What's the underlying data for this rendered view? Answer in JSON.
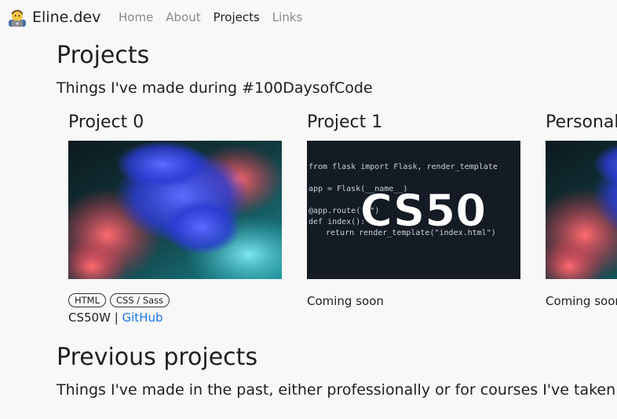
{
  "brand": {
    "name": "Eline.dev",
    "icon": "technologist-emoji-icon"
  },
  "nav": {
    "items": [
      {
        "label": "Home",
        "active": false
      },
      {
        "label": "About",
        "active": false
      },
      {
        "label": "Projects",
        "active": true
      },
      {
        "label": "Links",
        "active": false
      }
    ]
  },
  "projects": {
    "heading": "Projects",
    "intro": "Things I've made during #100DaysofCode",
    "cards": [
      {
        "title": "Project 0",
        "tags": [
          "HTML",
          "CSS / Sass"
        ],
        "credit_prefix": "CS50W",
        "credit_sep": " | ",
        "link_label": "GitHub"
      },
      {
        "title": "Project 1",
        "status": "Coming soon",
        "code": {
          "line1": "from flask import Flask, render_template",
          "line2": "app = Flask(__name__)",
          "line3": "@app.route(\"/\")",
          "line4": "def index():",
          "line5": "return render_template(\"index.html\")",
          "logo": "CS50"
        }
      },
      {
        "title": "Personal Website",
        "status": "Coming soon"
      }
    ]
  },
  "previous": {
    "heading": "Previous projects",
    "intro": "Things I've made in the past, either professionally or for courses I've taken."
  },
  "colors": {
    "link": "#1a73e8",
    "code_bg": "#151b24",
    "page_bg": "#f8f8f8"
  }
}
